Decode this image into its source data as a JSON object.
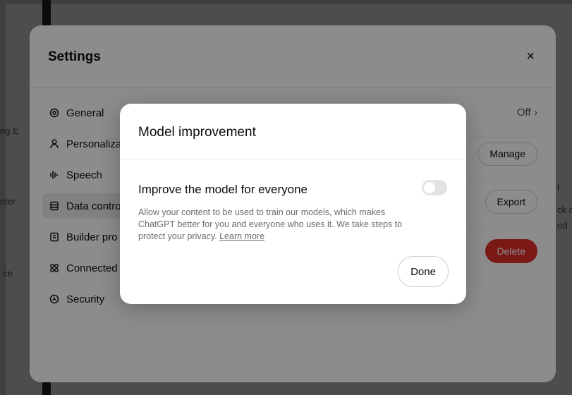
{
  "background": {
    "texts": [
      "ng E",
      "nter",
      "ce",
      "ck c",
      "od",
      "l"
    ]
  },
  "settings": {
    "title": "Settings",
    "close_icon": "×",
    "nav": [
      {
        "label": "General",
        "icon": "gear-icon"
      },
      {
        "label": "Personaliza",
        "icon": "person-icon"
      },
      {
        "label": "Speech",
        "icon": "waveform-icon"
      },
      {
        "label": "Data contro",
        "icon": "database-icon",
        "active": true
      },
      {
        "label": "Builder pro",
        "icon": "id-card-icon"
      },
      {
        "label": "Connected",
        "icon": "apps-icon"
      },
      {
        "label": "Security",
        "icon": "shield-icon"
      }
    ],
    "rows": {
      "off_label": "Off",
      "manage_label": "Manage",
      "export_label": "Export",
      "delete_label": "Delete"
    }
  },
  "modal": {
    "title": "Model improvement",
    "preference_label": "Improve the model for everyone",
    "toggle_on": false,
    "description": "Allow your content to be used to train our models, which makes ChatGPT better for you and everyone who uses it. We take steps to protect your privacy.",
    "learn_more": "Learn more",
    "done_label": "Done"
  },
  "colors": {
    "danger": "#e02e2a",
    "toggle_off": "#e3e3e3"
  }
}
